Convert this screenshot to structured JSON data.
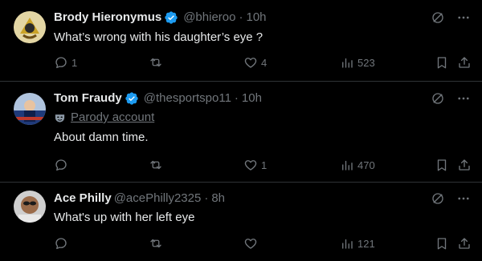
{
  "tweets": [
    {
      "name": "Brody Hieronymus",
      "handle": "@bhieroo",
      "time": "10h",
      "text": "What’s wrong with his daughter’s eye ?",
      "replies": "1",
      "retweets": "",
      "likes": "4",
      "views": "523"
    },
    {
      "name": "Tom Fraudy",
      "handle": "@thesportspo11",
      "time": "10h",
      "parody_label": "Parody account",
      "text": "About damn time.",
      "replies": "",
      "retweets": "",
      "likes": "1",
      "views": "470"
    },
    {
      "name": "Ace Philly",
      "handle": "@acePhilly2325",
      "time": "8h",
      "text": "What's up with her left eye",
      "replies": "",
      "retweets": "",
      "likes": "",
      "views": "121"
    }
  ],
  "separator": "·",
  "colors": {
    "background": "#000000",
    "text": "#e7e9ea",
    "muted": "#71767b",
    "verified": "#1d9bf0",
    "divider": "#2f3336"
  },
  "icons": [
    "grok-icon",
    "more-icon",
    "reply-icon",
    "retweet-icon",
    "like-icon",
    "views-icon",
    "bookmark-icon",
    "share-icon",
    "verified-badge-icon",
    "parody-mask-icon"
  ]
}
